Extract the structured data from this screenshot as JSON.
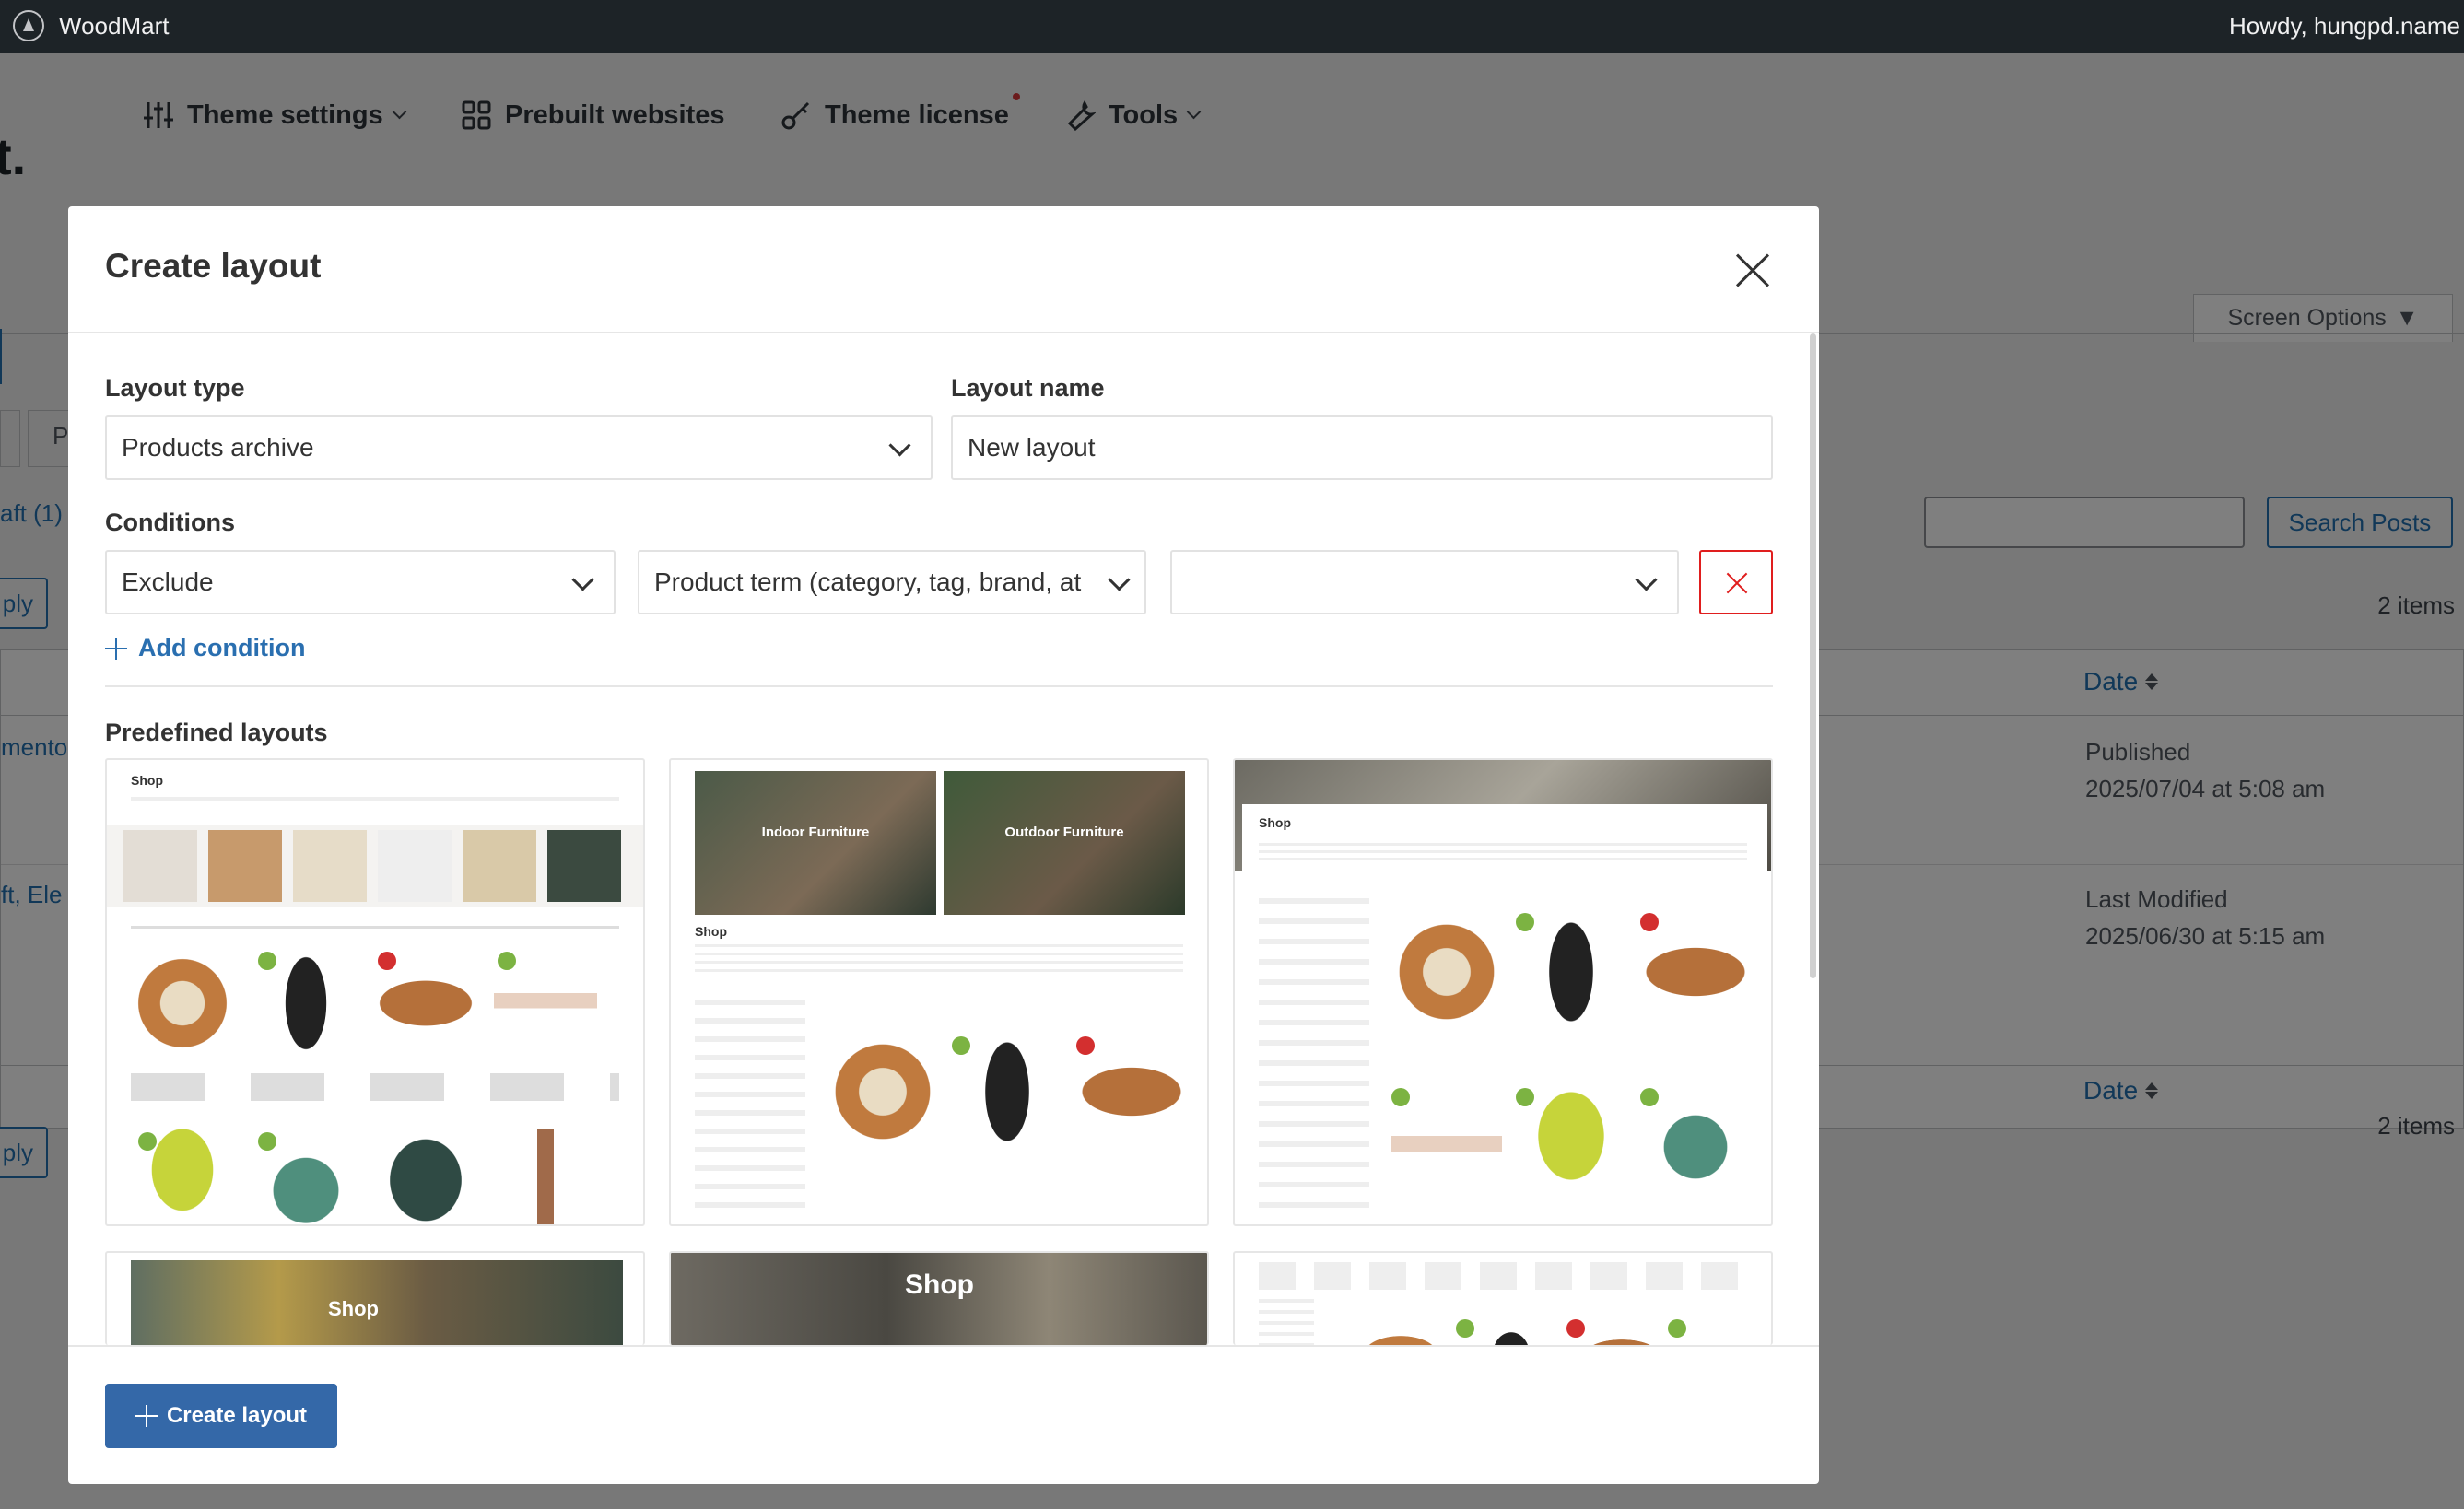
{
  "adminbar": {
    "site_name": "WoodMart",
    "greeting": "Howdy, hungpd.name"
  },
  "theme_nav": {
    "items": [
      {
        "label": "Theme settings",
        "icon": "sliders-icon",
        "has_dropdown": true
      },
      {
        "label": "Prebuilt websites",
        "icon": "grid-icon",
        "has_dropdown": false
      },
      {
        "label": "Theme license",
        "icon": "key-icon",
        "has_dropdown": false
      },
      {
        "label": "Tools",
        "icon": "wrench-icon",
        "has_dropdown": true
      }
    ]
  },
  "background": {
    "page_title_fragment": "t.",
    "screen_options": "Screen Options",
    "search_button": "Search Posts",
    "items_count_top": "2 items",
    "items_count_bottom": "2 items",
    "date_header": "Date",
    "date_footer": "Date",
    "row1": {
      "status": "Published",
      "date": "2025/07/04 at 5:08 am",
      "left_fragment": "mento"
    },
    "row2": {
      "status": "Last Modified",
      "date": "2025/06/30 at 5:15 am",
      "left_fragment": "ft, Ele"
    },
    "filter_fragment": "aft (1)",
    "tab_fragment": "P",
    "apply_fragment": "ply",
    "apply_fragment_bottom": "ply"
  },
  "modal": {
    "title": "Create layout",
    "layout_type_label": "Layout type",
    "layout_type_value": "Products archive",
    "layout_name_label": "Layout name",
    "layout_name_value": "New layout",
    "conditions_label": "Conditions",
    "condition": {
      "comparison": "Exclude",
      "type": "Product term (category, tag, brand, at",
      "value": ""
    },
    "add_condition": "Add condition",
    "predefined_label": "Predefined layouts",
    "thumbs": [
      {
        "shop_title": "Shop"
      },
      {
        "shop_title": "Shop",
        "banner_left": "Indoor Furniture",
        "banner_right": "Outdoor Furniture"
      },
      {
        "shop_title": "Shop"
      },
      {
        "shop_title": "Shop"
      },
      {
        "shop_title": "Shop"
      },
      {
        "shop_title": ""
      }
    ],
    "create_button": "Create layout"
  },
  "colors": {
    "accent": "#3468a8",
    "danger": "#e01e1e",
    "adminbar": "#1d2327",
    "link": "#2271b1"
  }
}
